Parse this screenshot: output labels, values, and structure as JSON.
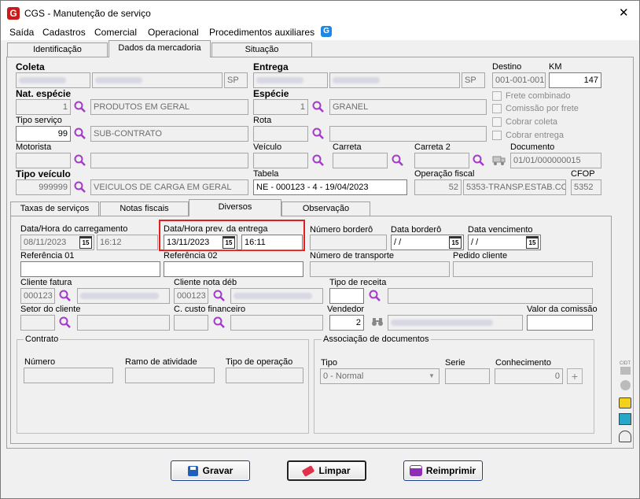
{
  "window": {
    "title": "CGS - Manutenção de serviço",
    "close": "✕",
    "logo": "G"
  },
  "menu": [
    "Saída",
    "Cadastros",
    "Comercial",
    "Operacional",
    "Procedimentos auxiliares"
  ],
  "top_tabs": [
    "Identificação",
    "Dados da mercadoria",
    "Situação"
  ],
  "coleta": {
    "label": "Coleta",
    "uf": "SP"
  },
  "entrega": {
    "label": "Entrega",
    "uf": "SP"
  },
  "destino": {
    "label": "Destino",
    "value": "001-001-001"
  },
  "km": {
    "label": "KM",
    "value": "147"
  },
  "nat_especie": {
    "label": "Nat. espécie",
    "code": "1",
    "desc": "PRODUTOS EM GERAL"
  },
  "especie": {
    "label": "Espécie",
    "code": "1",
    "desc": "GRANEL"
  },
  "tipo_servico": {
    "label": "Tipo serviço",
    "code": "99",
    "desc": "SUB-CONTRATO"
  },
  "rota": {
    "label": "Rota"
  },
  "checks": [
    "Frete combinado",
    "Comissão por frete",
    "Cobrar coleta",
    "Cobrar entrega"
  ],
  "motorista": {
    "label": "Motorista"
  },
  "veiculo": {
    "label": "Veículo"
  },
  "carreta": {
    "label": "Carreta"
  },
  "carreta2": {
    "label": "Carreta 2"
  },
  "documento": {
    "label": "Documento",
    "value": "01/01/000000015"
  },
  "tipo_veiculo": {
    "label": "Tipo veículo",
    "code": "999999",
    "desc": "VEICULOS DE CARGA EM GERAL"
  },
  "tabela": {
    "label": "Tabela",
    "value": "NE - 000123 - 4 - 19/04/2023"
  },
  "operacao_fiscal": {
    "label": "Operação fiscal",
    "code": "52",
    "desc": "5353-TRANSP.ESTAB.CO"
  },
  "cfop": {
    "label": "CFOP",
    "value": "5352"
  },
  "bottom_tabs": [
    "Taxas de serviços",
    "Notas fiscais",
    "Diversos",
    "Observação"
  ],
  "carregamento": {
    "label": "Data/Hora do carregamento",
    "date": "08/11/2023",
    "time": "16:12"
  },
  "prev_entrega": {
    "label": "Data/Hora prev. da entrega",
    "date": "13/11/2023",
    "time": "16:11"
  },
  "numero_bordero": {
    "label": "Número borderô"
  },
  "data_bordero": {
    "label": "Data borderô",
    "value": " / /"
  },
  "data_vencimento": {
    "label": "Data vencimento",
    "value": " / /"
  },
  "referencia01": {
    "label": "Referência 01"
  },
  "referencia02": {
    "label": "Referência 02"
  },
  "numero_transporte": {
    "label": "Número de transporte"
  },
  "pedido_cliente": {
    "label": "Pedido cliente"
  },
  "cliente_fatura": {
    "label": "Cliente fatura",
    "code": "000123"
  },
  "cliente_nota_deb": {
    "label": "Cliente nota déb",
    "code": "000123"
  },
  "tipo_receita": {
    "label": "Tipo de receita"
  },
  "setor_cliente": {
    "label": "Setor do cliente"
  },
  "custo_financeiro": {
    "label": "C. custo financeiro"
  },
  "vendedor": {
    "label": "Vendedor",
    "code": "2"
  },
  "valor_comissao": {
    "label": "Valor da comissão"
  },
  "contrato": {
    "label": "Contrato",
    "numero": "Número",
    "ramo": "Ramo de atividade",
    "tipo_op": "Tipo de operação"
  },
  "assoc": {
    "label": "Associação de documentos",
    "tipo": "Tipo",
    "tipo_value": "0 - Normal",
    "serie": "Serie",
    "conhecimento": "Conhecimento",
    "conhecimento_value": "0"
  },
  "buttons": {
    "gravar": "Gravar",
    "limpar": "Limpar",
    "reimprimir": "Reimprimir"
  },
  "side": {
    "cidt": "CIDT"
  },
  "cal_icon_text": "15"
}
